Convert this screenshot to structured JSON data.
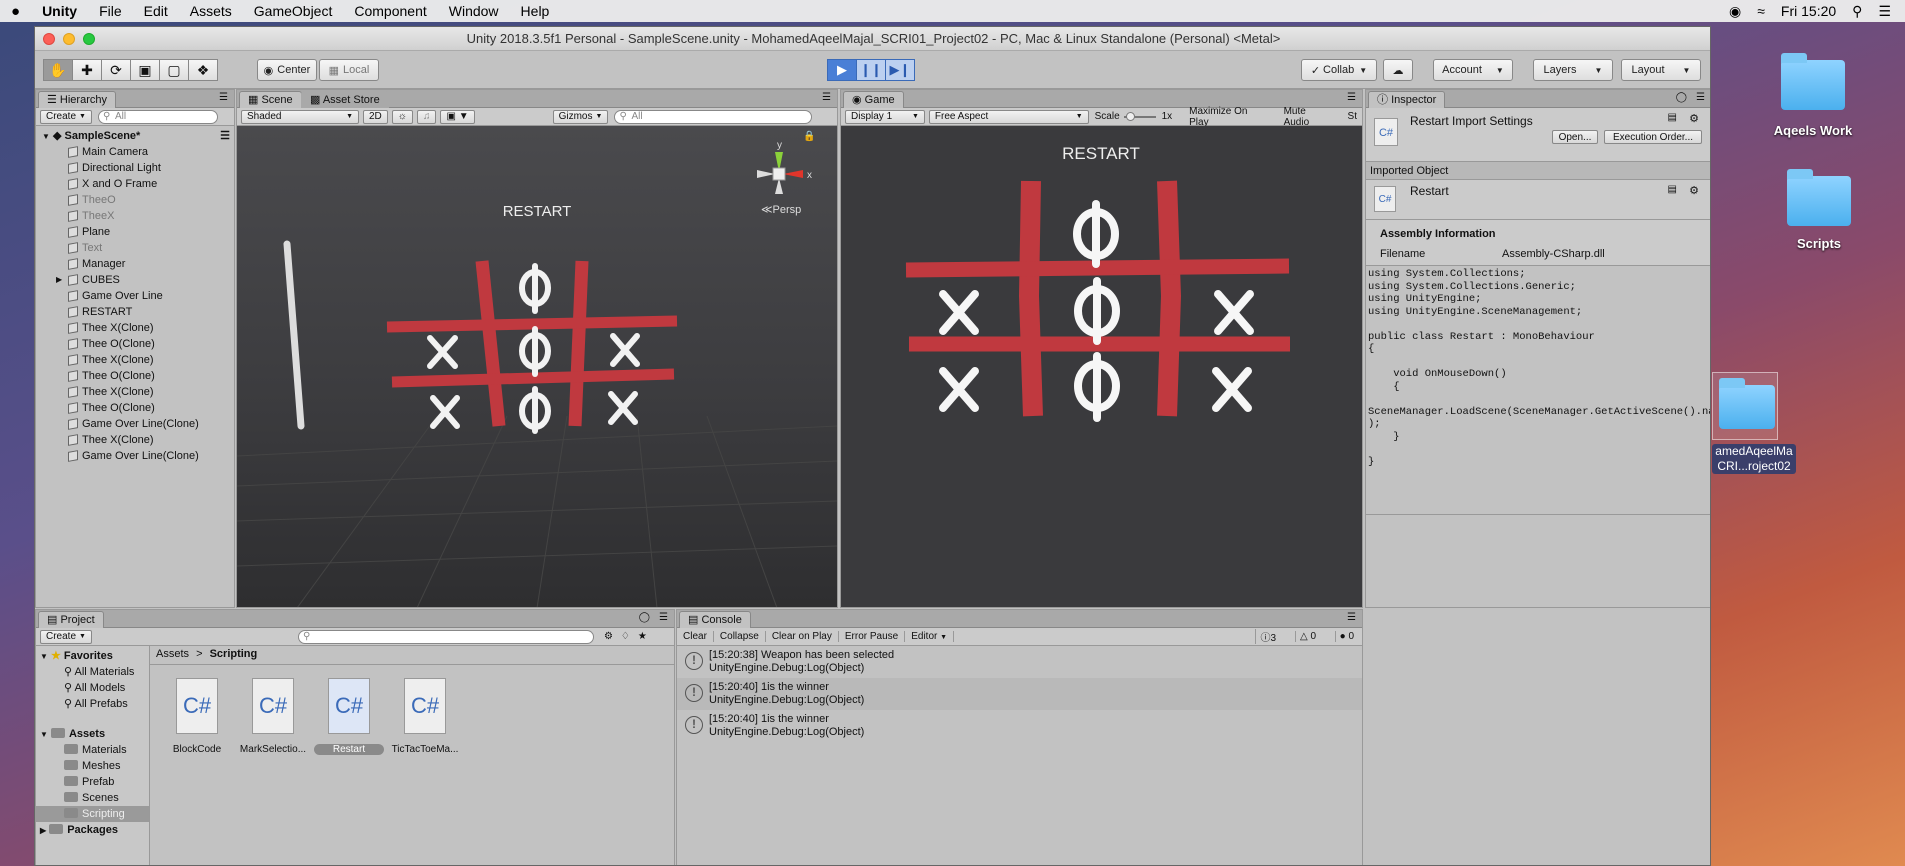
{
  "mac_menubar": {
    "apple": "",
    "app_name": "Unity",
    "items": [
      "File",
      "Edit",
      "Assets",
      "GameObject",
      "Component",
      "Window",
      "Help"
    ],
    "clock": "Fri 15:20"
  },
  "desktop": {
    "icons": [
      {
        "label": "Aqeels Work"
      },
      {
        "label": "Scripts"
      },
      {
        "label_line1": "amedAqeelMa",
        "label_line2": "CRI...roject02"
      }
    ]
  },
  "window": {
    "title": "Unity 2018.3.5f1 Personal - SampleScene.unity - MohamedAqeelMajal_SCRI01_Project02 - PC, Mac & Linux Standalone (Personal) <Metal>"
  },
  "toolbar": {
    "pivot": "Center",
    "space": "Local",
    "collab": "Collab",
    "account": "Account",
    "layers": "Layers",
    "layout": "Layout"
  },
  "hierarchy": {
    "tab": "Hierarchy",
    "create": "Create",
    "search_placeholder": "All",
    "scene": "SampleScene*",
    "items": [
      {
        "name": "Main Camera"
      },
      {
        "name": "Directional Light"
      },
      {
        "name": "X and O Frame"
      },
      {
        "name": "TheeO"
      },
      {
        "name": "TheeX"
      },
      {
        "name": "Plane"
      },
      {
        "name": "Text"
      },
      {
        "name": "Manager"
      },
      {
        "name": "CUBES"
      },
      {
        "name": "Game Over Line"
      },
      {
        "name": "RESTART"
      },
      {
        "name": "Thee X(Clone)"
      },
      {
        "name": "Thee O(Clone)"
      },
      {
        "name": "Thee X(Clone)"
      },
      {
        "name": "Thee O(Clone)"
      },
      {
        "name": "Thee X(Clone)"
      },
      {
        "name": "Thee O(Clone)"
      },
      {
        "name": "Game Over Line(Clone)"
      },
      {
        "name": "Thee X(Clone)"
      },
      {
        "name": "Game Over Line(Clone)"
      }
    ]
  },
  "scene": {
    "tab_scene": "Scene",
    "tab_asset_store": "Asset Store",
    "shading": "Shaded",
    "mode_2d": "2D",
    "gizmos": "Gizmos",
    "search_placeholder": "All",
    "persp": "Persp",
    "restart_text": "RESTART",
    "gizmo_y": "y",
    "gizmo_x": "x"
  },
  "game": {
    "tab": "Game",
    "display": "Display 1",
    "aspect": "Free Aspect",
    "scale_label": "Scale",
    "scale_value": "1x",
    "maximize": "Maximize On Play",
    "mute": "Mute Audio",
    "stats": "St",
    "restart_text": "RESTART"
  },
  "inspector": {
    "tab": "Inspector",
    "title": "Restart Import Settings",
    "open": "Open...",
    "exec_order": "Execution Order...",
    "imported_object": "Imported Object",
    "object_name": "Restart",
    "cs_label": "C#",
    "assembly_header": "Assembly Information",
    "filename_label": "Filename",
    "filename_value": "Assembly-CSharp.dll",
    "code": "using System.Collections;\nusing System.Collections.Generic;\nusing UnityEngine;\nusing UnityEngine.SceneManagement;\n\npublic class Restart : MonoBehaviour\n{\n\n    void OnMouseDown()\n    {\n\nSceneManager.LoadScene(SceneManager.GetActiveScene().name\n);\n    }\n\n}"
  },
  "project": {
    "tab": "Project",
    "create": "Create",
    "breadcrumb_root": "Assets",
    "breadcrumb_sep": ">",
    "breadcrumb_current": "Scripting",
    "favorites": "Favorites",
    "fav_items": [
      "All Materials",
      "All Models",
      "All Prefabs"
    ],
    "assets": "Assets",
    "asset_folders": [
      "Materials",
      "Meshes",
      "Prefab",
      "Scenes",
      "Scripting"
    ],
    "packages": "Packages",
    "files": [
      {
        "name": "BlockCode"
      },
      {
        "name": "MarkSelectio..."
      },
      {
        "name": "Restart"
      },
      {
        "name": "TicTacToeMa..."
      }
    ]
  },
  "console": {
    "tab": "Console",
    "buttons": [
      "Clear",
      "Collapse",
      "Clear on Play",
      "Error Pause",
      "Editor"
    ],
    "count_info": "3",
    "count_warn": "0",
    "count_error": "0",
    "logs": [
      {
        "line1": "[15:20:38] Weapon has been selected",
        "line2": "UnityEngine.Debug:Log(Object)"
      },
      {
        "line1": "[15:20:40] 1is the winner",
        "line2": "UnityEngine.Debug:Log(Object)"
      },
      {
        "line1": "[15:20:40] 1is the winner",
        "line2": "UnityEngine.Debug:Log(Object)"
      }
    ]
  },
  "colors": {
    "frame_red": "#c0393f",
    "mark_white": "#f2f2f2",
    "play_blue": "#4a7fd6"
  }
}
